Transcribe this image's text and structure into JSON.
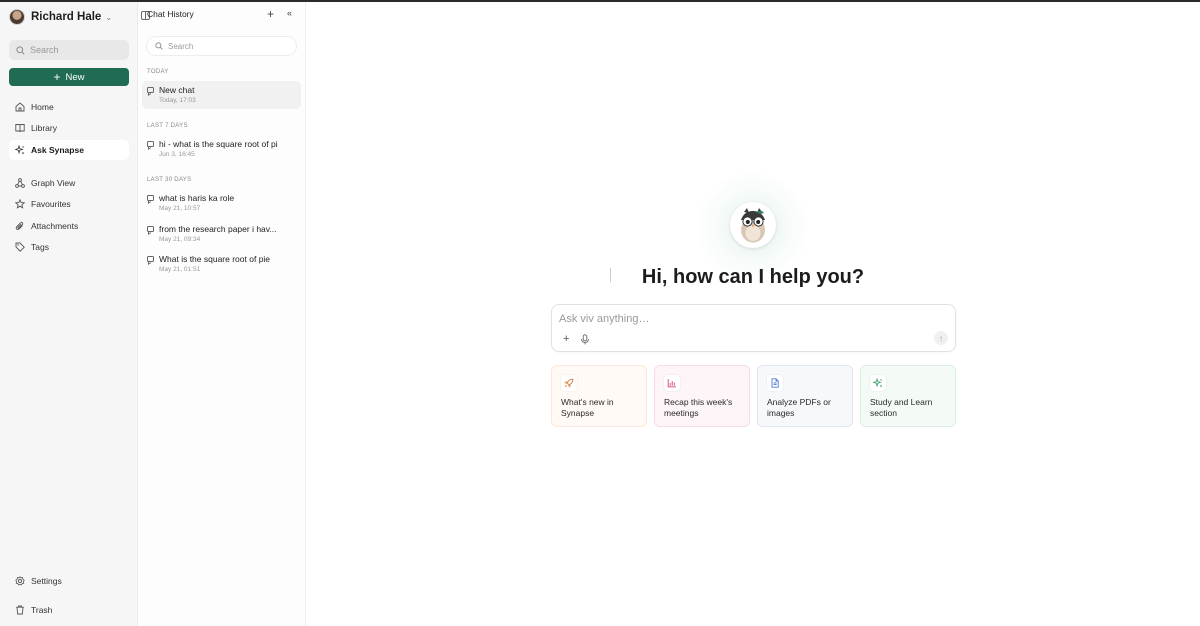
{
  "user": {
    "name": "Richard Hale"
  },
  "sidebar": {
    "search_placeholder": "Search",
    "new_label": "New",
    "nav": [
      {
        "label": "Home",
        "icon": "home-icon"
      },
      {
        "label": "Library",
        "icon": "book-icon"
      },
      {
        "label": "Ask Synapse",
        "icon": "sparkles-icon",
        "active": true
      },
      {
        "label": "Graph View",
        "icon": "graph-icon"
      },
      {
        "label": "Favourites",
        "icon": "star-icon"
      },
      {
        "label": "Attachments",
        "icon": "paperclip-icon"
      },
      {
        "label": "Tags",
        "icon": "tag-icon"
      }
    ],
    "settings_label": "Settings",
    "trash_label": "Trash"
  },
  "history": {
    "title": "Chat History",
    "search_placeholder": "Search",
    "sections": [
      {
        "label": "TODAY",
        "items": [
          {
            "title": "New chat",
            "time": "Today, 17:03",
            "active": true
          }
        ]
      },
      {
        "label": "LAST 7 DAYS",
        "items": [
          {
            "title": "hi - what is the square root of pi",
            "time": "Jun 3, 16:45"
          }
        ]
      },
      {
        "label": "LAST 30 DAYS",
        "items": [
          {
            "title": "what is haris ka role",
            "time": "May 21, 10:57"
          },
          {
            "title": "from the research paper i hav...",
            "time": "May 21, 09:34"
          },
          {
            "title": "What is the square root of pie",
            "time": "May 21, 01:51"
          }
        ]
      }
    ]
  },
  "main": {
    "greeting": "Hi, how can I help you?",
    "composer_placeholder": "Ask viv anything…",
    "suggestions": [
      {
        "label": "What's new in Synapse",
        "icon": "rocket-icon",
        "color": "#e07a3a",
        "bg": "#fff8f3",
        "border": "#fbe6d6"
      },
      {
        "label": "Recap this week's meetings",
        "icon": "bar-chart-icon",
        "color": "#d6457a",
        "bg": "#fdf4f7",
        "border": "#f6d8e4"
      },
      {
        "label": "Analyze PDFs or images",
        "icon": "document-icon",
        "color": "#4a79d6",
        "bg": "#f5f8fd",
        "border": "#dde6f5"
      },
      {
        "label": "Study and Learn section",
        "icon": "sparkles-icon",
        "color": "#2f9a63",
        "bg": "#f3fbf6",
        "border": "#d6efe1"
      }
    ]
  },
  "colors": {
    "accent": "#1f6b53"
  }
}
